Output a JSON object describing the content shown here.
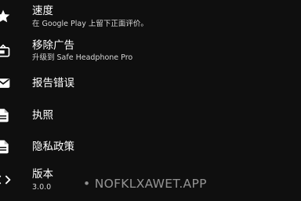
{
  "settings": {
    "items": [
      {
        "icon": "star-icon",
        "title": "速度",
        "subtitle": "在 Google Play 上留下正面评价。"
      },
      {
        "icon": "remove-ads-icon",
        "title": "移除广告",
        "subtitle": "升级到 Safe Headphone Pro"
      },
      {
        "icon": "mail-icon",
        "title": "报告错误",
        "subtitle": ""
      },
      {
        "icon": "document-icon",
        "title": "执照",
        "subtitle": ""
      },
      {
        "icon": "document-icon",
        "title": "隐私政策",
        "subtitle": ""
      },
      {
        "icon": "code-icon",
        "title": "版本",
        "subtitle": "3.0.0"
      }
    ]
  },
  "watermark": {
    "text": "NOFKLXAWET.APP"
  }
}
